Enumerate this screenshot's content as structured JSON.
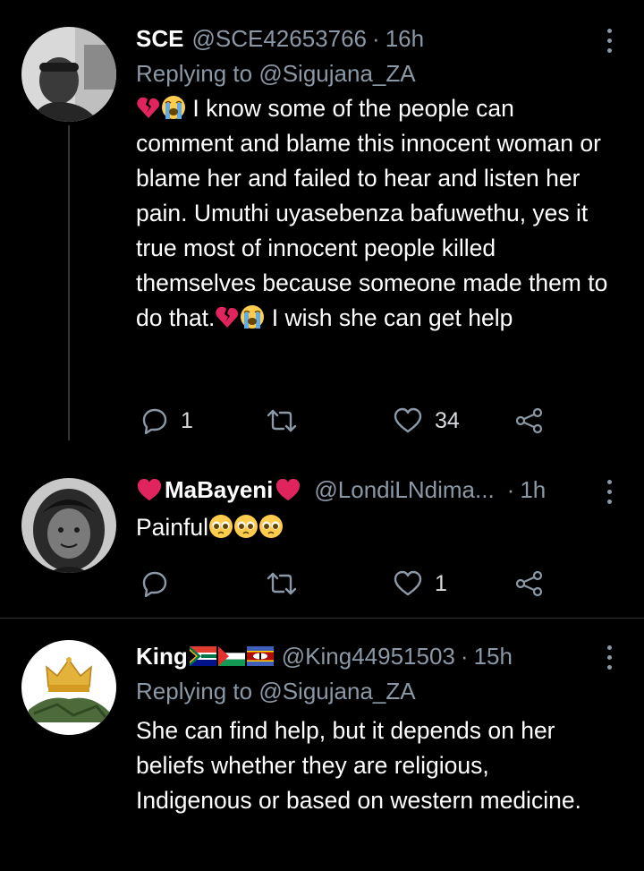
{
  "tweets": [
    {
      "name": "SCE",
      "handle": "@SCE42653766",
      "separator": "·",
      "time": "16h",
      "replying_prefix": "Replying to",
      "replying_to": "@Sigujana_ZA",
      "text_before": " I know some of the people can comment and blame this innocent woman or blame her and failed to hear and listen her pain. Umuthi uyasebenza bafuwethu, yes it true most of innocent people killed themselves because someone made them to do that.",
      "text_after": " I wish she can get help",
      "emojis": [
        "broken-heart",
        "crying-face"
      ],
      "replies": "1",
      "retweets": "",
      "likes": "34"
    },
    {
      "name": "MaBayeni",
      "name_emojis": [
        "red-heart",
        "red-heart"
      ],
      "handle": "@LondiLNdima...",
      "separator": "·",
      "time": "1h",
      "text": "Painful",
      "emojis": [
        "pleading-face",
        "pleading-face",
        "pleading-face"
      ],
      "replies": "",
      "retweets": "",
      "likes": "1"
    },
    {
      "name": "King",
      "name_flags": [
        "south-africa-flag",
        "palestine-flag",
        "eswatini-flag"
      ],
      "handle": "@King44951503",
      "separator": "·",
      "time": "15h",
      "replying_prefix": "Replying to",
      "replying_to": "@Sigujana_ZA",
      "text": "She can find help, but it depends on her beliefs whether they are religious, Indigenous or based on western medicine."
    }
  ],
  "colors": {
    "background": "#000000",
    "primary_text": "#ffffff",
    "secondary_text": "#8b98a5",
    "divider": "#2f3336",
    "heart_red": "#e0245e"
  }
}
